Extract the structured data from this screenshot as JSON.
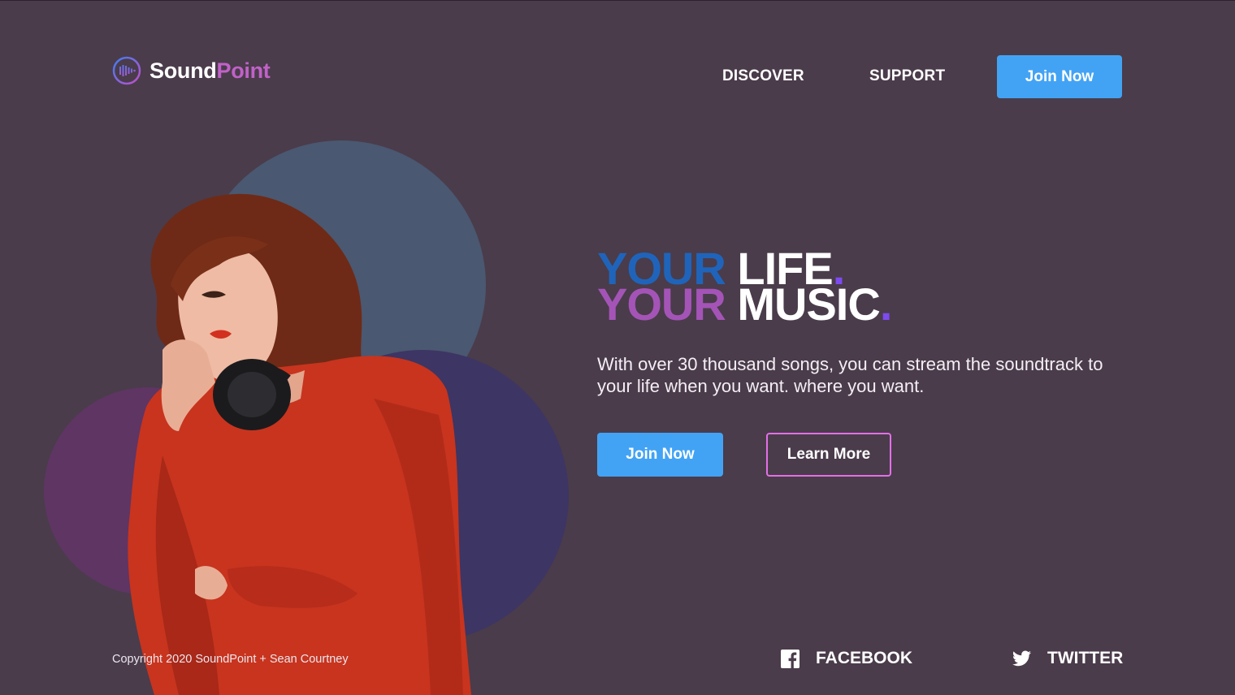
{
  "brand": {
    "name_part1": "Sound",
    "name_part2": "Point",
    "logo_icon": "soundwave-icon"
  },
  "nav": {
    "links": [
      "DISCOVER",
      "SUPPORT"
    ],
    "cta": "Join Now"
  },
  "hero": {
    "line1_word1": "YOUR",
    "line1_word2": "LIFE",
    "line2_word1": "YOUR",
    "line2_word2": "MUSIC",
    "dot": ".",
    "description": "With over 30 thousand songs, you can stream the soundtrack to your life when you want. where you want.",
    "primary_cta": "Join Now",
    "secondary_cta": "Learn More"
  },
  "footer": {
    "copyright": "Copyright 2020 SoundPoint + Sean Courtney",
    "social": [
      {
        "label": "FACEBOOK",
        "icon": "facebook-icon"
      },
      {
        "label": "TWITTER",
        "icon": "twitter-icon"
      }
    ]
  },
  "colors": {
    "background": "#4a3c4b",
    "accent_blue": "#42a3f5",
    "accent_pink": "#e46fe8",
    "headline_blue": "#1f64ba",
    "headline_purple": "#a454b6",
    "sweater_red": "#c8341e"
  }
}
